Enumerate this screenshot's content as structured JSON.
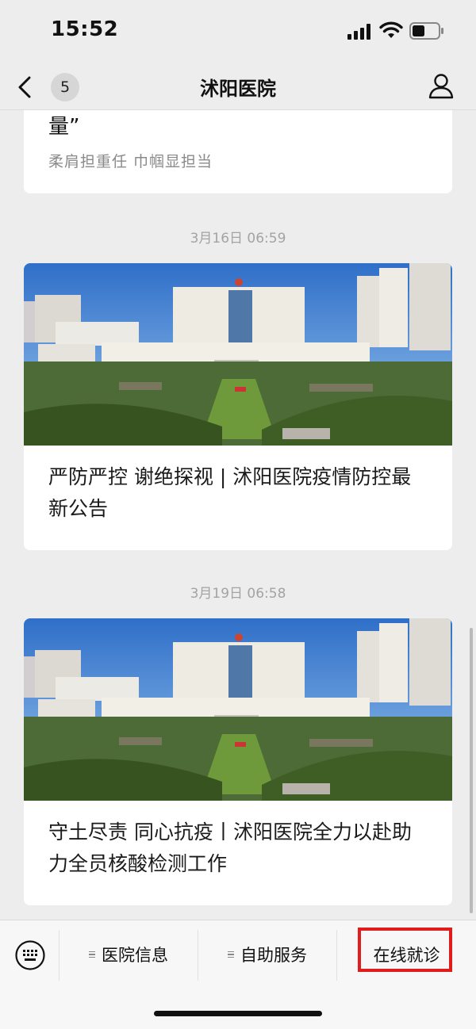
{
  "status_bar": {
    "time": "15:52"
  },
  "nav": {
    "back_badge": "5",
    "title": "沭阳医院"
  },
  "feed": {
    "top_card": {
      "title_tail": "量”",
      "subtitle": "柔肩担重任  巾帼显担当"
    },
    "items": [
      {
        "timestamp": "3月16日 06:59",
        "headline": "严防严控  谢绝探视 | 沭阳医院疫情防控最新公告"
      },
      {
        "timestamp": "3月19日 06:58",
        "headline": "守土尽责 同心抗疫丨沭阳医院全力以赴助力全员核酸检测工作"
      }
    ]
  },
  "menu": {
    "items": [
      "医院信息",
      "自助服务",
      "在线就诊"
    ],
    "highlighted": "在线就诊",
    "highlight_color": "#e21b1b"
  },
  "icons": [
    "back-chevron-icon",
    "user-profile-icon",
    "keyboard-icon",
    "signal-icon",
    "wifi-icon",
    "battery-icon",
    "menu-hamburger-icon"
  ]
}
